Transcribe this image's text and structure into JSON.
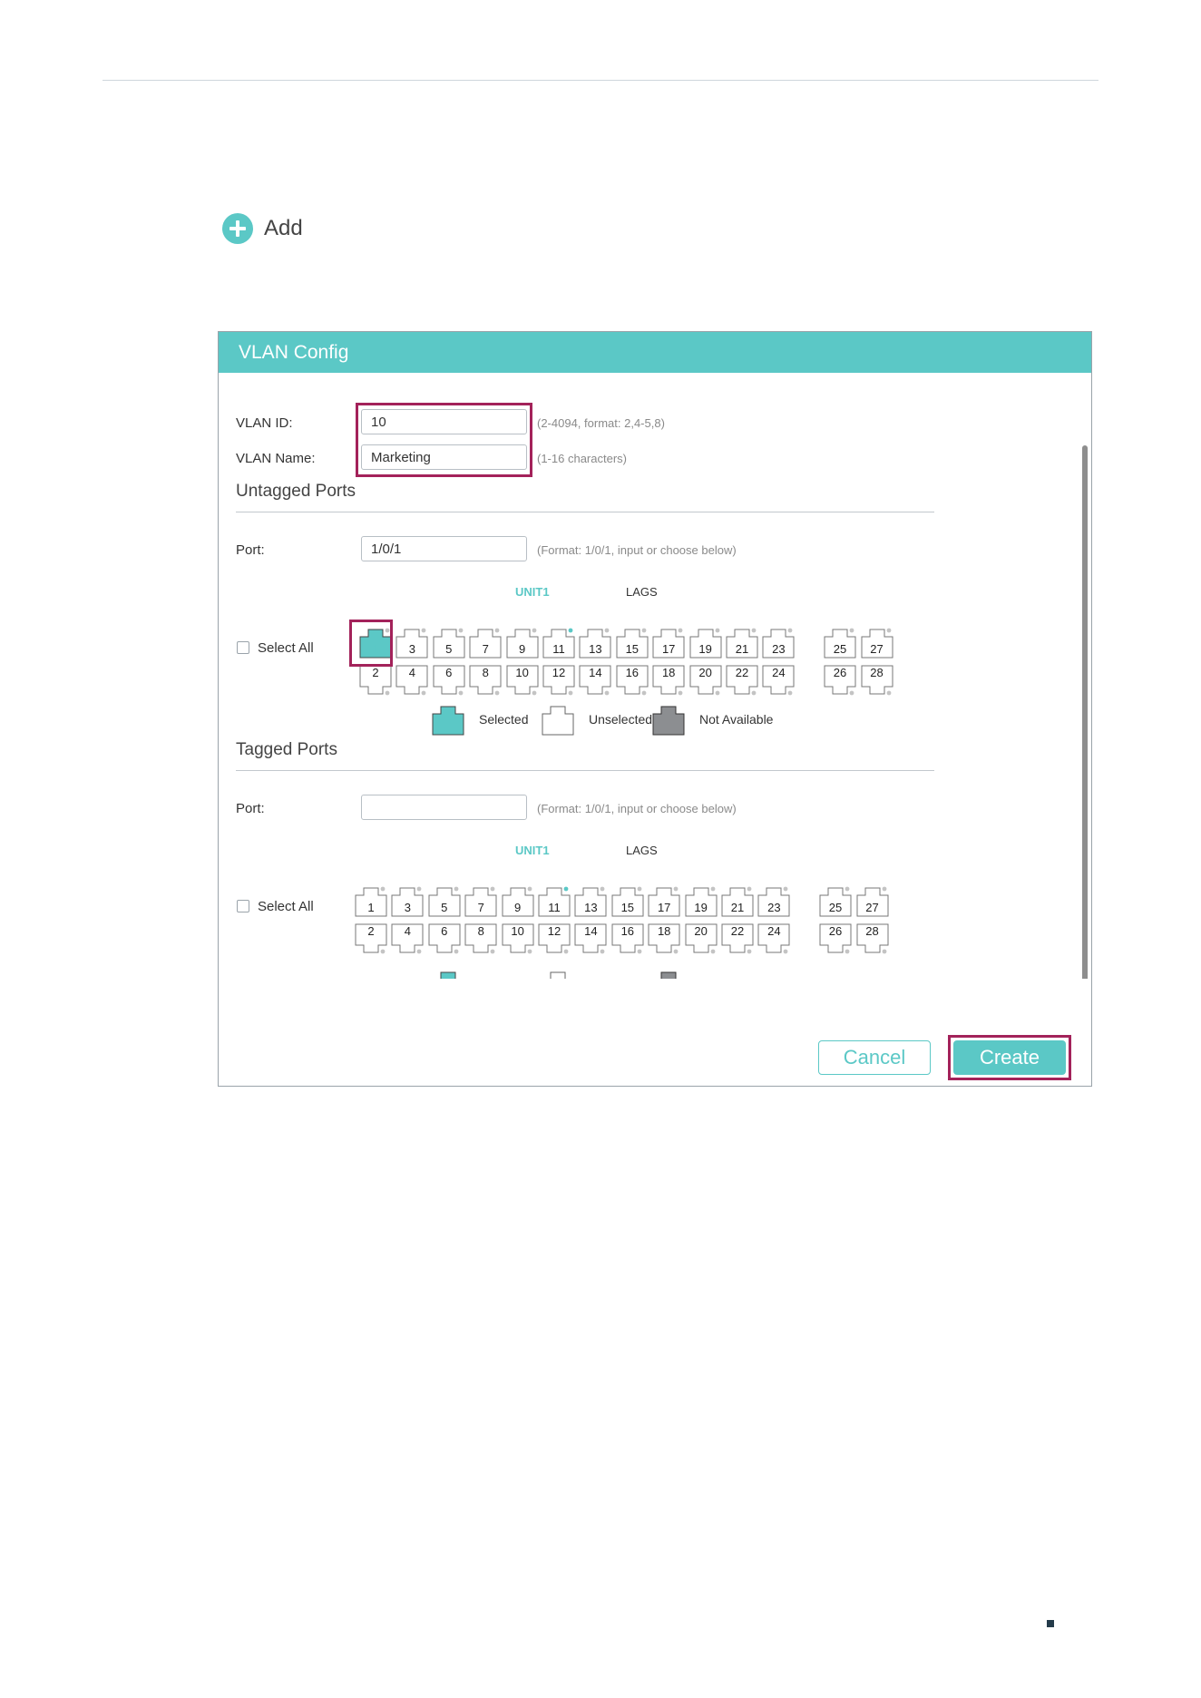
{
  "toolbar": {
    "add_label": "Add"
  },
  "dialog": {
    "title": "VLAN Config",
    "vlan_id": {
      "label": "VLAN ID:",
      "value": "10",
      "hint": "(2-4094, format: 2,4-5,8)"
    },
    "vlan_name": {
      "label": "VLAN Name:",
      "value": "Marketing",
      "hint": "(1-16 characters)"
    },
    "untagged": {
      "title": "Untagged Ports",
      "port_label": "Port:",
      "port_value": "1/0/1",
      "port_hint": "(Format: 1/0/1, input or choose below)",
      "unit_label": "UNIT1",
      "lags_label": "LAGS",
      "select_all": "Select All",
      "selected_ports": [
        "1"
      ],
      "linked_ports": [
        "11"
      ]
    },
    "tagged": {
      "title": "Tagged Ports",
      "port_label": "Port:",
      "port_value": "",
      "port_hint": "(Format: 1/0/1, input or choose below)",
      "unit_label": "UNIT1",
      "lags_label": "LAGS",
      "select_all": "Select All",
      "selected_ports": [],
      "linked_ports": [
        "11"
      ]
    },
    "ports": {
      "top": [
        "1",
        "3",
        "5",
        "7",
        "9",
        "11",
        "13",
        "15",
        "17",
        "19",
        "21",
        "23"
      ],
      "bottom": [
        "2",
        "4",
        "6",
        "8",
        "10",
        "12",
        "14",
        "16",
        "18",
        "20",
        "22",
        "24"
      ],
      "lags_top": [
        "25",
        "27"
      ],
      "lags_bottom": [
        "26",
        "28"
      ]
    },
    "legend": {
      "selected": "Selected",
      "unselected": "Unselected",
      "not_available": "Not Available"
    },
    "cancel_label": "Cancel",
    "create_label": "Create"
  },
  "colors": {
    "accent": "#5bc8c6",
    "highlight": "#a3225a",
    "not_available": "#8c8e91"
  }
}
